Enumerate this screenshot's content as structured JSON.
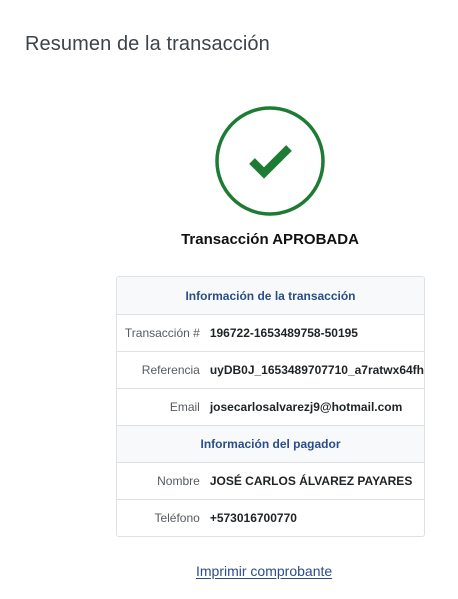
{
  "page": {
    "title": "Resumen de la transacción"
  },
  "status": {
    "icon": "check-circle-icon",
    "text": "Transacción APROBADA",
    "color": "#1e7b34"
  },
  "transaction_info": {
    "header": "Información de la transacción",
    "rows": [
      {
        "label": "Transacción #",
        "value": "196722-1653489758-50195"
      },
      {
        "label": "Referencia",
        "value": "uyDB0J_1653489707710_a7ratwx64fh"
      },
      {
        "label": "Email",
        "value": "josecarlosalvarezj9@hotmail.com"
      }
    ]
  },
  "payer_info": {
    "header": "Información del pagador",
    "rows": [
      {
        "label": "Nombre",
        "value": "JOSÉ CARLOS ÁLVAREZ PAYARES"
      },
      {
        "label": "Teléfono",
        "value": "+573016700770"
      }
    ]
  },
  "actions": {
    "print_label": "Imprimir comprobante"
  },
  "colors": {
    "accent": "#2a4e85",
    "success": "#1e7b34",
    "border": "#dee2e6",
    "header_bg": "#f8f9fa"
  }
}
